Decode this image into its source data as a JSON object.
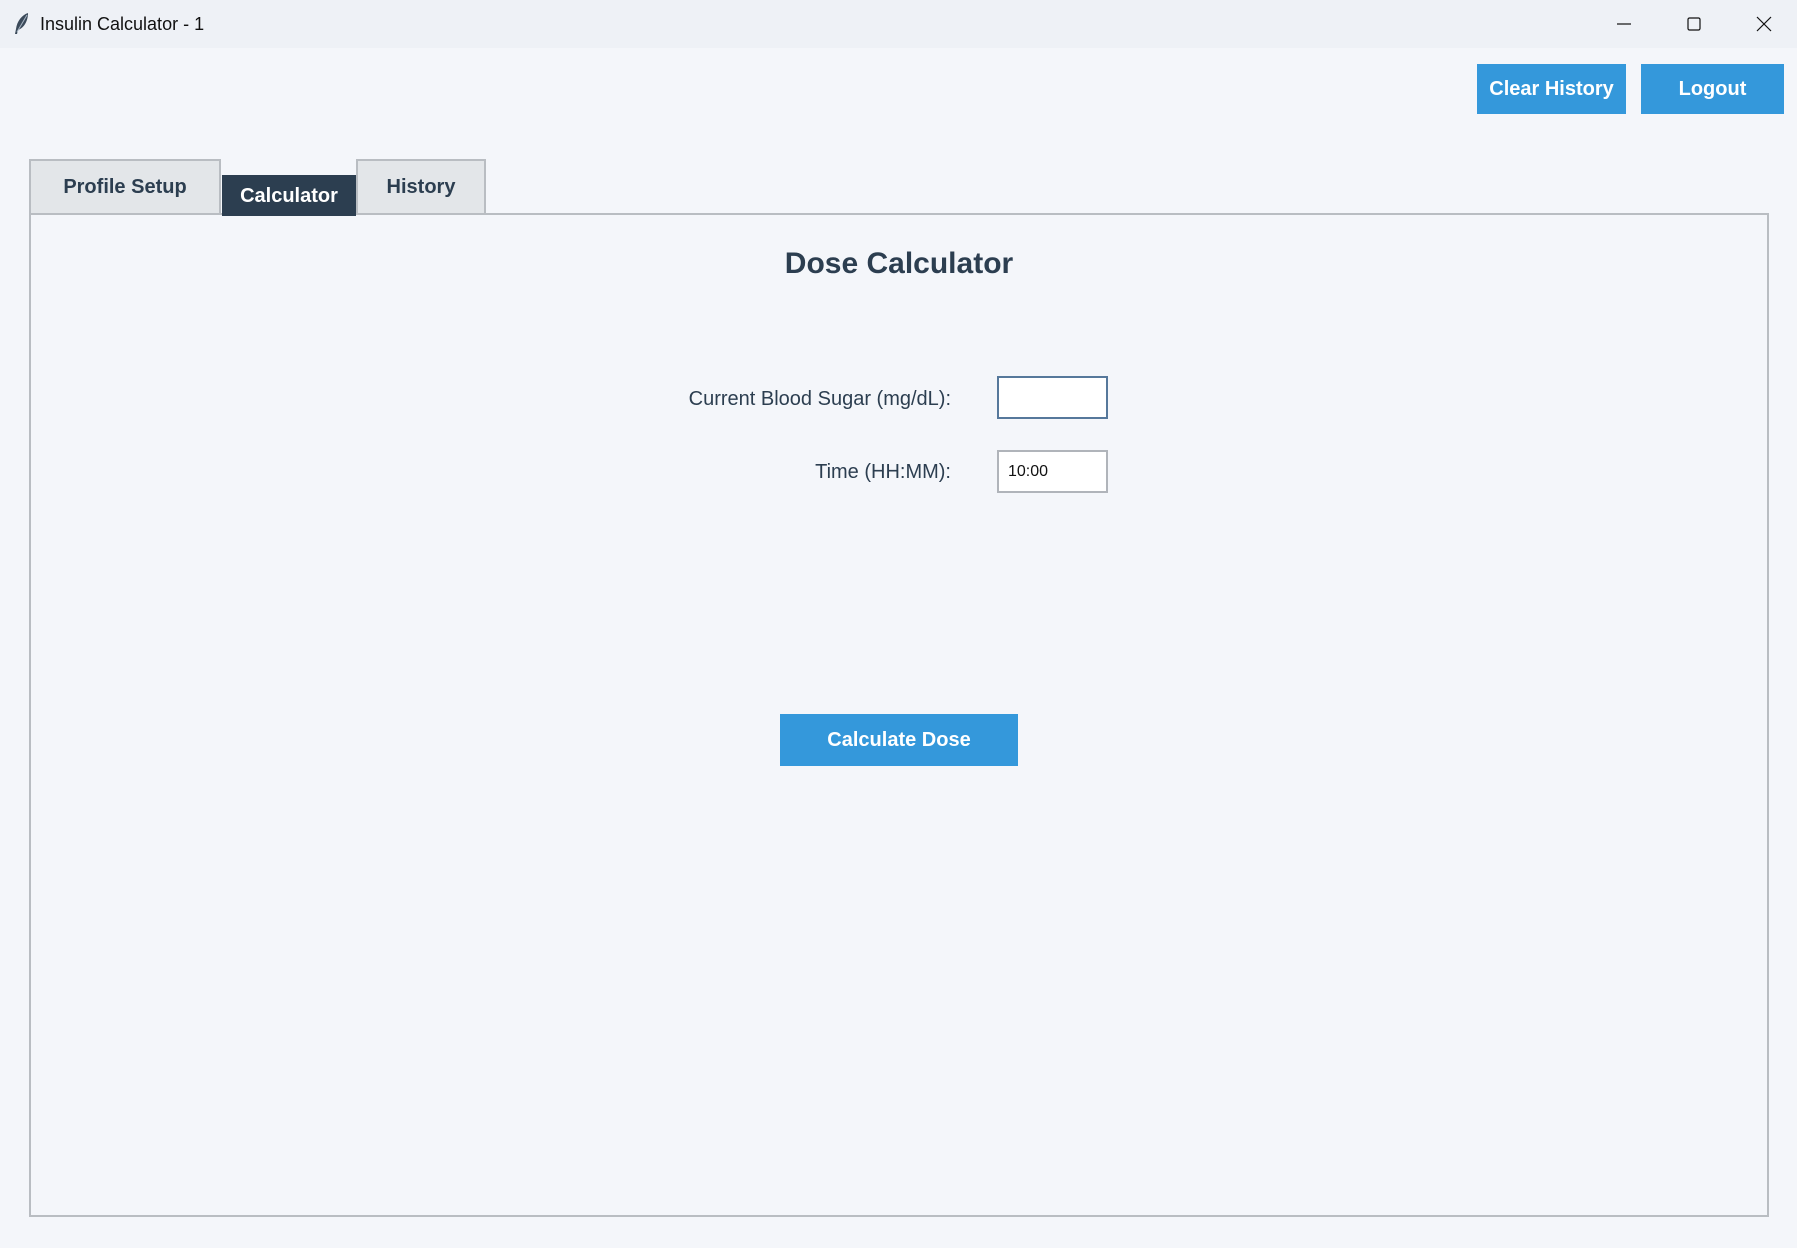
{
  "window": {
    "title": "Insulin Calculator - 1",
    "app_icon": "feather-icon",
    "controls": [
      "minimize-icon",
      "maximize-icon",
      "close-icon"
    ]
  },
  "header": {
    "clear_history_label": "Clear History",
    "logout_label": "Logout"
  },
  "tabs": [
    {
      "label": "Profile Setup",
      "active": false
    },
    {
      "label": "Calculator",
      "active": true
    },
    {
      "label": "History",
      "active": false
    }
  ],
  "calculator": {
    "title": "Dose Calculator",
    "blood_sugar_label": "Current Blood Sugar (mg/dL):",
    "blood_sugar_value": "",
    "time_label": "Time (HH:MM):",
    "time_value": "10:00",
    "calculate_label": "Calculate Dose"
  },
  "colors": {
    "accent": "#3498db",
    "dark": "#2c3e50",
    "background": "#f4f6fa"
  }
}
